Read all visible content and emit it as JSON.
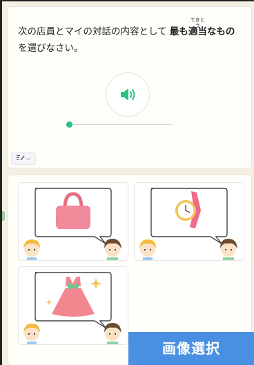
{
  "question": {
    "text_before": "次の店員とマイの対話の内容として ",
    "emphasis_part1": "最も",
    "emphasis_ruby_base": "適当",
    "emphasis_ruby_text": "てきとう",
    "emphasis_part2": "なもの",
    "text_after": "を選びなさい。"
  },
  "audio": {
    "progress": 0.0,
    "speaker_icon": "speaker-icon"
  },
  "tool_button": {
    "icon": "edit-list-icon",
    "chevron": "⌵"
  },
  "choices": [
    {
      "id": 1,
      "item": "handbag"
    },
    {
      "id": 2,
      "item": "wristwatch"
    },
    {
      "id": 3,
      "item": "dress"
    }
  ],
  "select_button": {
    "label": "画像選択"
  },
  "colors": {
    "accent_green": "#29c27f",
    "button_blue": "#4a90e2",
    "bag_pink": "#f08a9a",
    "watch_band": "#f06a87",
    "dress_pink": "#f3878f",
    "bow_green": "#67c98b"
  }
}
